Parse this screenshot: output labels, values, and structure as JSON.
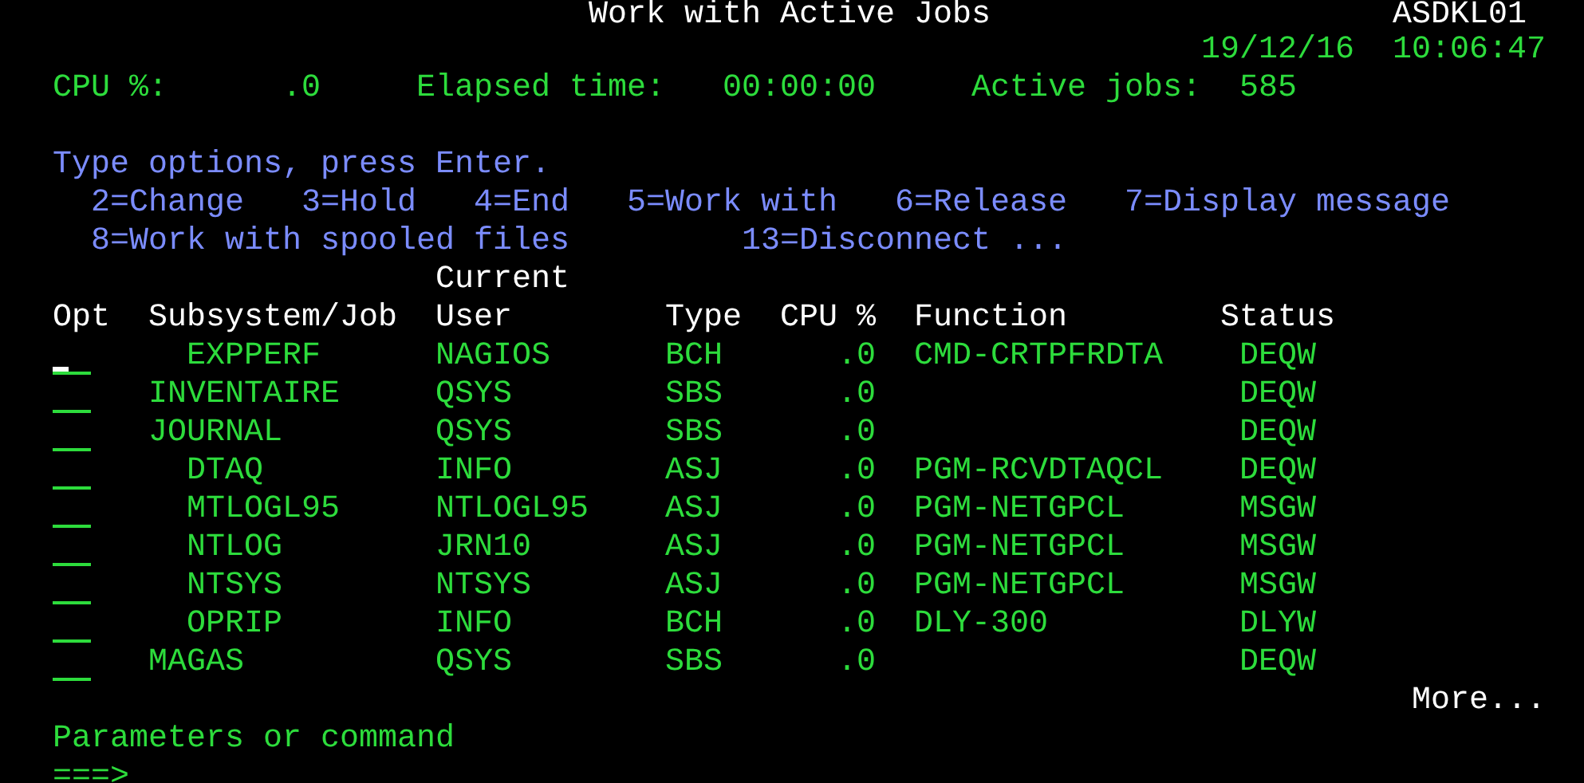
{
  "header": {
    "title": "Work with Active Jobs",
    "system": "ASDKL01",
    "date": "19/12/16",
    "time": "10:06:47"
  },
  "summary": [
    {
      "label": "CPU %:",
      "value": ".0"
    },
    {
      "label": "Elapsed time:",
      "value": "00:00:00"
    },
    {
      "label": "Active jobs:",
      "value": "585"
    }
  ],
  "instructions": "Type options, press Enter.",
  "options": [
    [
      "2=Change",
      "3=Hold",
      "4=End",
      "5=Work with",
      "6=Release",
      "7=Display message"
    ],
    [
      "8=Work with spooled files",
      "13=Disconnect ..."
    ]
  ],
  "columns": {
    "opt": "Opt",
    "job": "Subsystem/Job",
    "user_top": "Current",
    "user": "User",
    "type": "Type",
    "cpu": "CPU %",
    "function": "Function",
    "status": "Status"
  },
  "rows": [
    {
      "kind": "job",
      "name": "EXPPERF",
      "user": "NAGIOS",
      "type": "BCH",
      "cpu": ".0",
      "function": "CMD-CRTPFRDTA",
      "status": "DEQW",
      "cursor": true
    },
    {
      "kind": "subsystem",
      "name": "INVENTAIRE",
      "user": "QSYS",
      "type": "SBS",
      "cpu": ".0",
      "status": "DEQW",
      "cursor": false
    },
    {
      "kind": "subsystem",
      "name": "JOURNAL",
      "user": "QSYS",
      "type": "SBS",
      "cpu": ".0",
      "status": "DEQW",
      "cursor": false
    },
    {
      "kind": "job",
      "name": "DTAQ",
      "user": "INFO",
      "type": "ASJ",
      "cpu": ".0",
      "function": "PGM-RCVDTAQCL",
      "status": "DEQW",
      "cursor": false
    },
    {
      "kind": "job",
      "name": "MTLOGL95",
      "user": "NTLOGL95",
      "type": "ASJ",
      "cpu": ".0",
      "function": "PGM-NETGPCL",
      "status": "MSGW",
      "cursor": false
    },
    {
      "kind": "job",
      "name": "NTLOG",
      "user": "JRN10",
      "type": "ASJ",
      "cpu": ".0",
      "function": "PGM-NETGPCL",
      "status": "MSGW",
      "cursor": false
    },
    {
      "kind": "job",
      "name": "NTSYS",
      "user": "NTSYS",
      "type": "ASJ",
      "cpu": ".0",
      "function": "PGM-NETGPCL",
      "status": "MSGW",
      "cursor": false
    },
    {
      "kind": "job",
      "name": "OPRIP",
      "user": "INFO",
      "type": "BCH",
      "cpu": ".0",
      "function": "DLY-300",
      "status": "DLYW",
      "cursor": false
    },
    {
      "kind": "subsystem",
      "name": "MAGAS",
      "user": "QSYS",
      "type": "SBS",
      "cpu": ".0",
      "status": "DEQW",
      "cursor": false
    }
  ],
  "more": "More...",
  "command": {
    "label": "Parameters or command",
    "prompt": "===>"
  }
}
